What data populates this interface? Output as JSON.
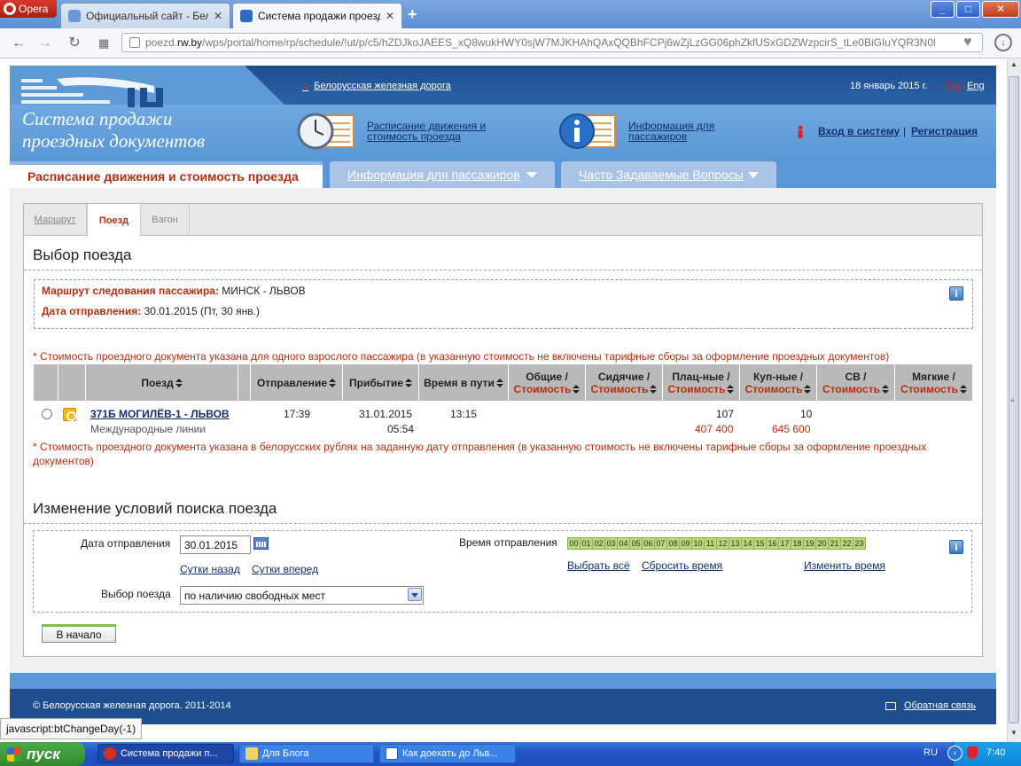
{
  "browser": {
    "menu_label": "Opera",
    "tabs": [
      {
        "title": "Официальный сайт - Белор",
        "active": false
      },
      {
        "title": "Система продажи проездн",
        "active": true
      }
    ],
    "url_prefix": "poezd.",
    "url_domain": "rw.by",
    "url_path": "/wps/portal/home/rp/schedule/!ut/p/c5/hZDJkoJAEES_xQ8wukHWY0sjW7MJKHAhQAxQQBhFCPj6wZjLzGG06phZkfUSxGDZWzpcirS_tLe0BiGIuYQR3N0l",
    "status_url": "javascript:btChangeDay(-1)"
  },
  "header": {
    "site_title_line1": "Система продажи",
    "site_title_line2": "проездных документов",
    "home_link": "Белорусская железная дорога",
    "current_date": "18 январь 2015 г.",
    "lang_rus": "Рус",
    "lang_eng": "Eng",
    "schedule_link": "Расписание движения и стоимость проезда",
    "info_link": "Информация для пассажиров",
    "login": "Вход в систему",
    "separator": "|",
    "register": "Регистрация"
  },
  "mainnav": {
    "tab_schedule": "Расписание движения и стоимость проезда",
    "tab_info": "Информация для пассажиров",
    "tab_faq": "Часто Задаваемые Вопросы"
  },
  "steps": {
    "route": "Маршрут",
    "train": "Поезд",
    "wagon": "Вагон"
  },
  "selection": {
    "title": "Выбор поезда",
    "route_label": "Маршрут следования пассажира:",
    "route_value": "МИНСК - ЛЬВОВ",
    "date_label": "Дата отправления:",
    "date_value": "30.01.2015 (Пт, 30 янв.)",
    "note_top": "* Стоимость проездного документа указана для одного взрослого пассажира (в указанную стоимость не включены тарифные сборы за оформление проездных документов)",
    "note_bottom": "* Стоимость проездного документа указана в белорусских рублях на заданную дату отправления (в указанную стоимость не включены тарифные сборы за оформление проездных документов)"
  },
  "table": {
    "headers": {
      "train": "Поезд",
      "departure": "Отправление",
      "arrival": "Прибытие",
      "duration": "Время в пути",
      "common": "Общие /",
      "seated": "Сидячие /",
      "plac": "Плац-ные /",
      "kup": "Куп-ные /",
      "sv": "СВ /",
      "soft": "Мягкие /",
      "cost": "Стоимость"
    },
    "rows": [
      {
        "train": "371Б МОГИЛЁВ-1 - ЛЬВОВ",
        "train_type": "Международные линии",
        "departure": "17:39",
        "arrival_date": "31.01.2015",
        "arrival_time": "05:54",
        "duration": "13:15",
        "plac_seats": "107",
        "plac_price": "407 400",
        "kup_seats": "10",
        "kup_price": "645 600"
      }
    ]
  },
  "search": {
    "title": "Изменение условий поиска поезда",
    "date_label": "Дата отправления",
    "date_value": "30.01.2015",
    "prev_day": "Сутки назад",
    "next_day": "Сутки вперед",
    "train_label": "Выбор поезда",
    "train_select": "по наличию свободных мест",
    "time_label": "Время отправления",
    "hours": [
      "00",
      "01",
      "02",
      "03",
      "04",
      "05",
      "06",
      "07",
      "08",
      "09",
      "10",
      "11",
      "12",
      "13",
      "14",
      "15",
      "16",
      "17",
      "18",
      "19",
      "20",
      "21",
      "22",
      "23"
    ],
    "select_all": "Выбрать всё",
    "reset_time": "Сбросить время",
    "change_time": "Изменить время",
    "start_button": "В начало"
  },
  "footer": {
    "copyright": "© Белорусская железная дорога. 2011-2014",
    "feedback": "Обратная связь"
  },
  "taskbar": {
    "start": "пуск",
    "tasks": [
      {
        "label": "Система продажи п...",
        "active": true
      },
      {
        "label": "Для Блога",
        "active": false
      },
      {
        "label": "Как доехать до Льв...",
        "active": false
      }
    ],
    "lang": "RU",
    "time": "7:40"
  },
  "colors": {
    "brand_dark": "#1e4e8e",
    "brand_light": "#5a97d6",
    "accent_red": "#b43010",
    "link_blue": "#12306a"
  }
}
